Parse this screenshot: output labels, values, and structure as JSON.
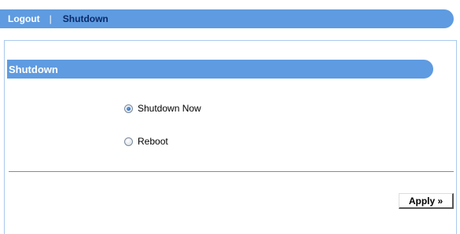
{
  "nav": {
    "logout_label": "Logout",
    "separator": "|",
    "current_label": "Shutdown"
  },
  "section": {
    "title": "Shutdown"
  },
  "options": [
    {
      "label": "Shutdown Now",
      "checked": true
    },
    {
      "label": "Reboot",
      "checked": false
    }
  ],
  "actions": {
    "apply_label": "Apply »"
  },
  "colors": {
    "accent": "#5f9be0",
    "current_nav": "#0a2a6a"
  }
}
